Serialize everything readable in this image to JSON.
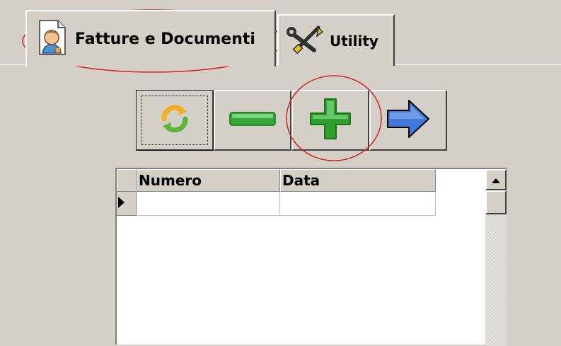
{
  "tabs": [
    {
      "label": "Fatture e Documenti",
      "icon": "document-user-icon",
      "active": true
    },
    {
      "label": "Utility",
      "icon": "tools-icon",
      "active": false
    }
  ],
  "toolbar": {
    "buttons": [
      {
        "name": "refresh-button",
        "icon": "refresh-icon"
      },
      {
        "name": "delete-button",
        "icon": "minus-icon"
      },
      {
        "name": "add-button",
        "icon": "plus-icon"
      },
      {
        "name": "next-button",
        "icon": "arrow-right-icon"
      }
    ]
  },
  "grid": {
    "columns": [
      "Numero",
      "Data"
    ],
    "rows": [
      {
        "numero": "",
        "data": ""
      }
    ]
  },
  "colors": {
    "background": "#d4d0c8",
    "annotation": "#d42020",
    "plus_green": "#2ea02e",
    "arrow_blue": "#3f78d8"
  }
}
